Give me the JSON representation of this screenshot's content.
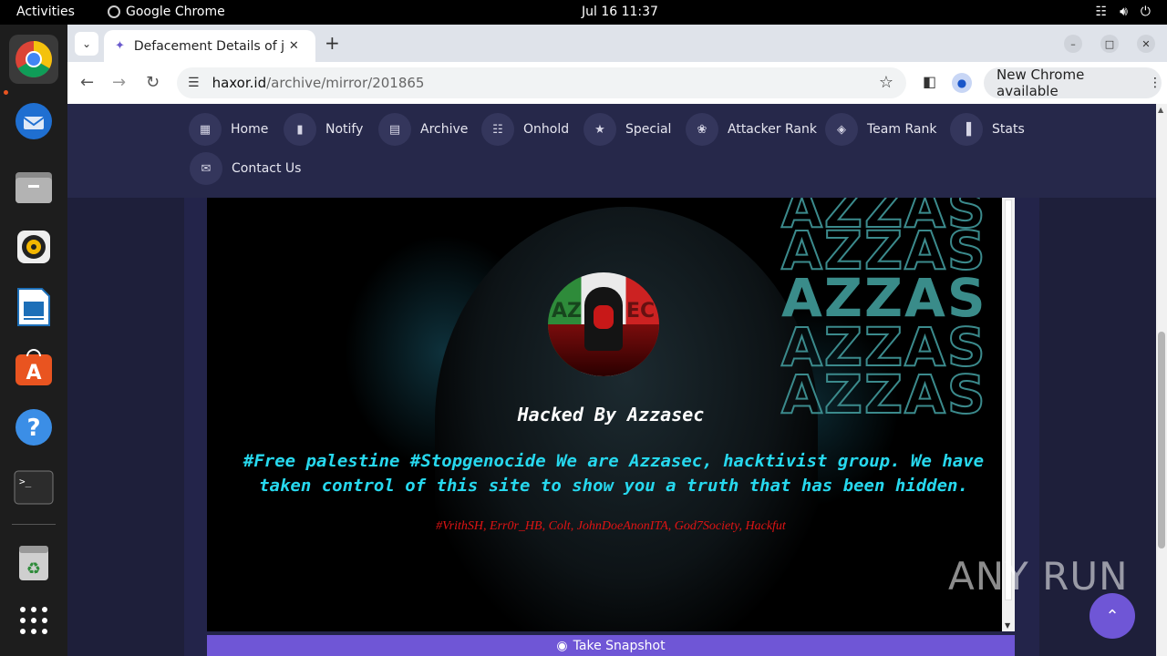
{
  "topbar": {
    "activities": "Activities",
    "app_name": "Google Chrome",
    "clock": "Jul 16  11:37"
  },
  "dock": {
    "apps": [
      "chrome-icon",
      "thunderbird-icon",
      "files-icon",
      "rhythmbox-icon",
      "writer-icon",
      "app-center-icon",
      "help-icon",
      "terminal-icon",
      "trash-icon",
      "app-grid-icon"
    ]
  },
  "browser": {
    "tab_title": "Defacement Details of ja",
    "url_host": "haxor.id",
    "url_path": "/archive/mirror/201865",
    "update_label": "New Chrome available"
  },
  "site_nav": {
    "items": [
      {
        "label": "Home",
        "icon": "dashboard-icon"
      },
      {
        "label": "Notify",
        "icon": "bookmark-icon"
      },
      {
        "label": "Archive",
        "icon": "archive-icon"
      },
      {
        "label": "Onhold",
        "icon": "document-icon"
      },
      {
        "label": "Special",
        "icon": "shield-icon"
      },
      {
        "label": "Attacker Rank",
        "icon": "award-icon"
      },
      {
        "label": "Team Rank",
        "icon": "layers-icon"
      },
      {
        "label": "Stats",
        "icon": "chart-icon"
      },
      {
        "label": "Contact Us",
        "icon": "mail-icon"
      }
    ]
  },
  "mirror": {
    "banner_word": "AZZAS",
    "logo_left": "AZ",
    "logo_right": "EC",
    "headline": "Hacked By Azzasec",
    "message": "#Free palestine #Stopgenocide We are Azzasec, hacktivist group. We have taken control of this site to show you a truth that has been hidden.",
    "credits": "#VrithSH, Err0r_HB, Colt, JohnDoeAnonITA, God7Society, Hackfut"
  },
  "actions": {
    "snapshot_label": "Take Snapshot"
  },
  "watermark": "ANY RUN",
  "colors": {
    "accent": "#6f56d6",
    "message": "#27d8ee",
    "credits": "#e01414",
    "nav_bg": "#26284a"
  }
}
